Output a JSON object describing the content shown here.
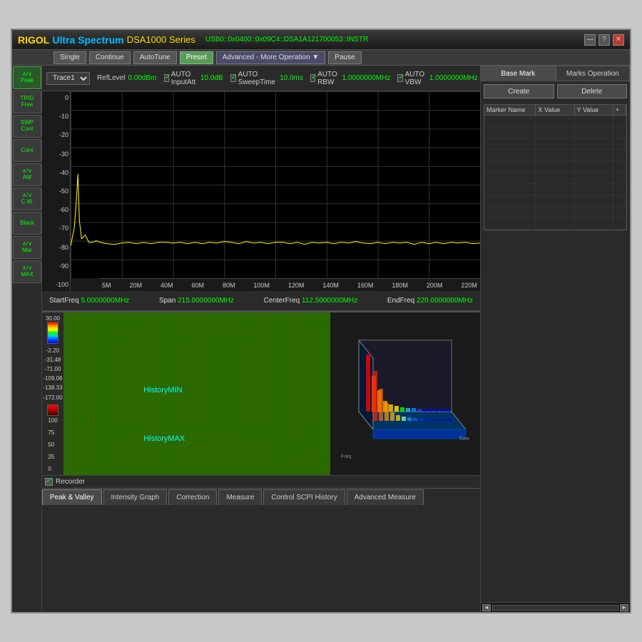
{
  "app": {
    "title_rigol": "RIGOL",
    "title_ultra": " Ultra Spectrum ",
    "title_dsa": "DSA1000 Series",
    "usb_info": "USB0::0x0400::0x09C4::DSA1A121700053::INSTR",
    "controls": {
      "minimize": "—",
      "help": "?",
      "close": "✕"
    }
  },
  "toolbar": {
    "single": "Single",
    "continue": "Continue",
    "autotune": "AutoTune",
    "preset": "Preset",
    "advanced": "Advanced - More Operation ▼",
    "pause": "Pause"
  },
  "sidebar": {
    "items": [
      {
        "label": "∧/∨\nPeak",
        "active": true
      },
      {
        "label": "TRIG\nFree",
        "active": false
      },
      {
        "label": "SWP\nCont",
        "active": false
      },
      {
        "label": "Cont",
        "active": false
      },
      {
        "label": "∧/∨\nAW",
        "active": false
      },
      {
        "label": "∧/∨\nC.W.",
        "active": false
      },
      {
        "label": "Blank",
        "active": false
      },
      {
        "label": "∧/∨\nMar",
        "active": false
      },
      {
        "label": "∧/∨\nMAX",
        "active": false
      }
    ]
  },
  "params": {
    "trace": "Trace1",
    "ref_level_label": "RefLevel",
    "ref_level_value": "0.00dBm",
    "auto_input_att": "AUTO InputAtt",
    "input_att_value": "10.0dB",
    "auto_sweep_time": "AUTO SweepTime",
    "sweep_time_value": "10.0ms",
    "auto_rbw": "AUTO RBW",
    "rbw_value": "1.0000000MHz",
    "auto_vbw": "AUTO VBW",
    "vbw_value": "1.0000000MHz"
  },
  "spectrum": {
    "y_labels": [
      "0",
      "-10",
      "-20",
      "-30",
      "-40",
      "-50",
      "-60",
      "-70",
      "-80",
      "-90",
      "-100"
    ],
    "x_labels": [
      "5M",
      "20M",
      "40M",
      "60M",
      "80M",
      "100M",
      "120M",
      "140M",
      "160M",
      "180M",
      "200M",
      "220M"
    ]
  },
  "freq_info": {
    "start_label": "StartFreq",
    "start_value": "5.0000000MHz",
    "span_label": "Span",
    "span_value": "215.0000000MHz",
    "center_label": "CenterFreq",
    "center_value": "112.5000000MHz",
    "end_label": "EndFreq",
    "end_value": "220.0000000MHz"
  },
  "right_panel": {
    "tab_base_mark": "Base Mark",
    "tab_marks_op": "Marks Operation",
    "btn_create": "Create",
    "btn_delete": "Delete",
    "col_marker_name": "Marker Name",
    "col_x_value": "X Value",
    "col_y_value": "Y Value",
    "marker_rows": []
  },
  "color_scale": {
    "values": [
      "30.00",
      "-2.20",
      "-31.48",
      "-71.00",
      "-109.06",
      "-138.33",
      "-172.00"
    ],
    "red_values": [
      "100",
      "75",
      "50",
      "25",
      "0"
    ]
  },
  "waterfall": {
    "label_min": "HistoryMIN",
    "label_max": "HistoryMAX"
  },
  "recorder": {
    "label": "Recorder"
  },
  "bottom_tabs": [
    {
      "label": "Peak & Valley",
      "active": true
    },
    {
      "label": "Intensity Graph",
      "active": false
    },
    {
      "label": "Correction",
      "active": false
    },
    {
      "label": "Measure",
      "active": false
    },
    {
      "label": "Control SCPI History",
      "active": false
    },
    {
      "label": "Advanced Measure",
      "active": false
    }
  ]
}
